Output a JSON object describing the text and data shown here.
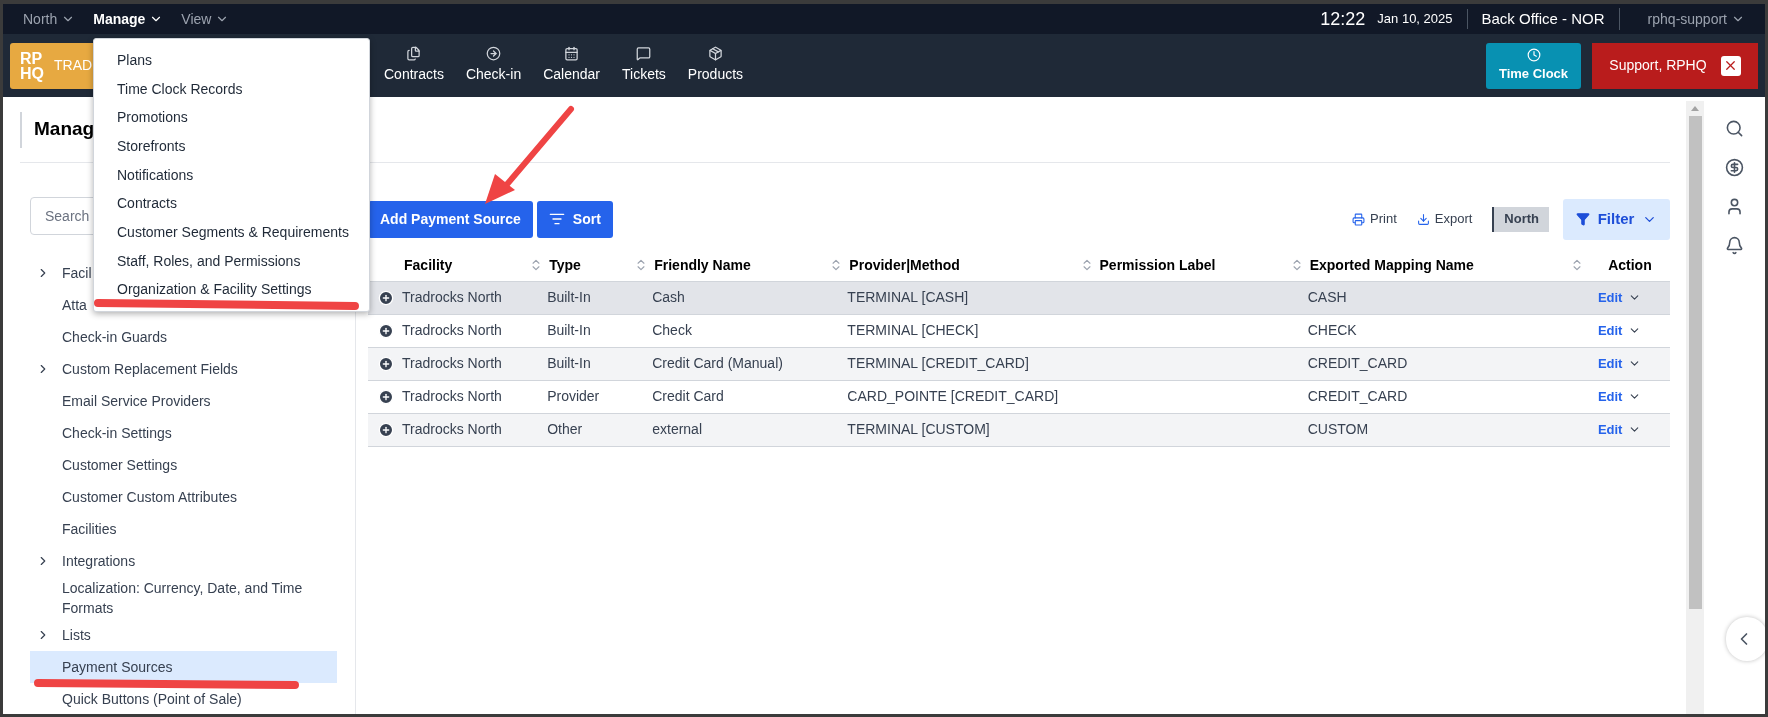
{
  "top_bar": {
    "menus": [
      {
        "label": "North",
        "selected": false
      },
      {
        "label": "Manage",
        "selected": true
      },
      {
        "label": "View",
        "selected": false
      }
    ],
    "time": "12:22",
    "date": "Jan 10, 2025",
    "location": "Back Office - NOR",
    "user": "rphq-support"
  },
  "nav_bar": {
    "logo": "RP HQ",
    "brand": "TRAD",
    "items": [
      {
        "label": "Contracts",
        "kind": "files"
      },
      {
        "label": "Check-in",
        "kind": "checkin"
      },
      {
        "label": "Calendar",
        "kind": "calendar"
      },
      {
        "label": "Tickets",
        "kind": "chat"
      },
      {
        "label": "Products",
        "kind": "box"
      }
    ],
    "time_clock": "Time Clock",
    "support": "Support, RPHQ"
  },
  "manage_menu": [
    "Plans",
    "Time Clock Records",
    "Promotions",
    "Storefronts",
    "Notifications",
    "Contracts",
    "Customer Segments & Requirements",
    "Staff, Roles, and Permissions",
    "Organization & Facility Settings"
  ],
  "page": {
    "title": "Manag"
  },
  "sidebar": {
    "search": {
      "placeholder": "Search"
    },
    "items": [
      {
        "label": "Facil",
        "expandable": true,
        "selected": false
      },
      {
        "label": "Atta",
        "expandable": false,
        "selected": false
      },
      {
        "label": "Check-in Guards",
        "expandable": false,
        "selected": false
      },
      {
        "label": "Custom Replacement Fields",
        "expandable": true,
        "selected": false
      },
      {
        "label": "Email Service Providers",
        "expandable": false,
        "selected": false
      },
      {
        "label": "Check-in Settings",
        "expandable": false,
        "selected": false
      },
      {
        "label": "Customer Settings",
        "expandable": false,
        "selected": false
      },
      {
        "label": "Customer Custom Attributes",
        "expandable": false,
        "selected": false
      },
      {
        "label": "Facilities",
        "expandable": false,
        "selected": false
      },
      {
        "label": "Integrations",
        "expandable": true,
        "selected": false
      },
      {
        "label": "Localization: Currency, Date, and Time Formats",
        "expandable": false,
        "selected": false
      },
      {
        "label": "Lists",
        "expandable": true,
        "selected": false
      },
      {
        "label": "Payment Sources",
        "expandable": false,
        "selected": true
      },
      {
        "label": "Quick Buttons (Point of Sale)",
        "expandable": false,
        "selected": false
      }
    ]
  },
  "toolbar": {
    "add": "Add Payment Source",
    "sort": "Sort",
    "print": "Print",
    "export": "Export",
    "facility": "North",
    "filter": "Filter"
  },
  "table": {
    "columns": [
      {
        "label": "Facility",
        "sortable": true
      },
      {
        "label": "Type",
        "sortable": true
      },
      {
        "label": "Friendly Name",
        "sortable": true
      },
      {
        "label": "Provider|Method",
        "sortable": true
      },
      {
        "label": "Permission Label",
        "sortable": true
      },
      {
        "label": "Exported Mapping Name",
        "sortable": true
      },
      {
        "label": "Action",
        "sortable": false
      }
    ],
    "rows": [
      {
        "cells": [
          "Tradrocks North",
          "Built-In",
          "Cash",
          "TERMINAL [CASH]",
          "",
          "CASH"
        ],
        "action": "Edit",
        "highlighted": true
      },
      {
        "cells": [
          "Tradrocks North",
          "Built-In",
          "Check",
          "TERMINAL [CHECK]",
          "",
          "CHECK"
        ],
        "action": "Edit",
        "highlighted": false
      },
      {
        "cells": [
          "Tradrocks North",
          "Built-In",
          "Credit Card (Manual)",
          "TERMINAL [CREDIT_CARD]",
          "",
          "CREDIT_CARD"
        ],
        "action": "Edit",
        "highlighted": false
      },
      {
        "cells": [
          "Tradrocks North",
          "Provider",
          "Credit Card",
          "CARD_POINTE [CREDIT_CARD]",
          "",
          "CREDIT_CARD"
        ],
        "action": "Edit",
        "highlighted": false
      },
      {
        "cells": [
          "Tradrocks North",
          "Other",
          "external",
          "TERMINAL [CUSTOM]",
          "",
          "CUSTOM"
        ],
        "action": "Edit",
        "highlighted": false
      }
    ]
  }
}
